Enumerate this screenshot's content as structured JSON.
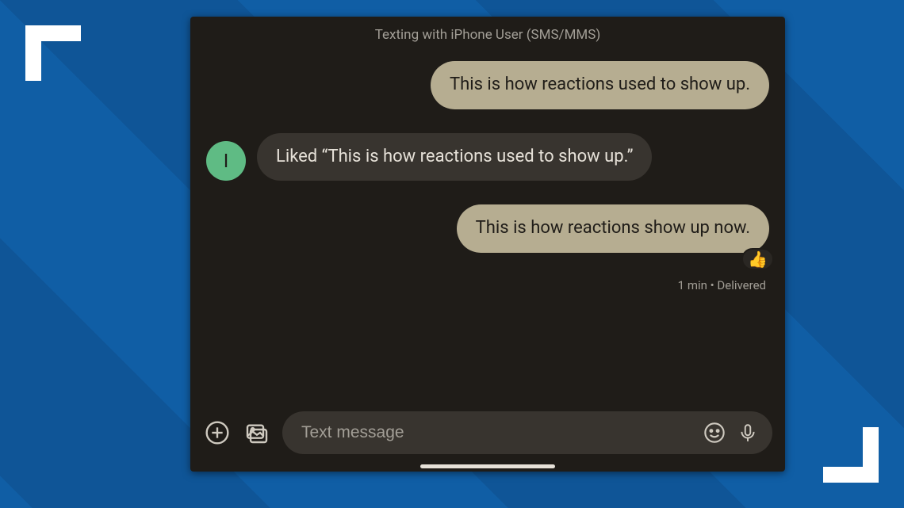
{
  "header": {
    "title": "Texting with iPhone User (SMS/MMS)"
  },
  "contact": {
    "initial": "I"
  },
  "messages": {
    "sent1": "This is how reactions used to show up.",
    "recv1": "Liked “This is how reactions used to show up.”",
    "sent2": "This is how reactions show up now.",
    "reaction_emoji": "👍",
    "status": "1 min • Delivered"
  },
  "compose": {
    "placeholder": "Text message"
  }
}
